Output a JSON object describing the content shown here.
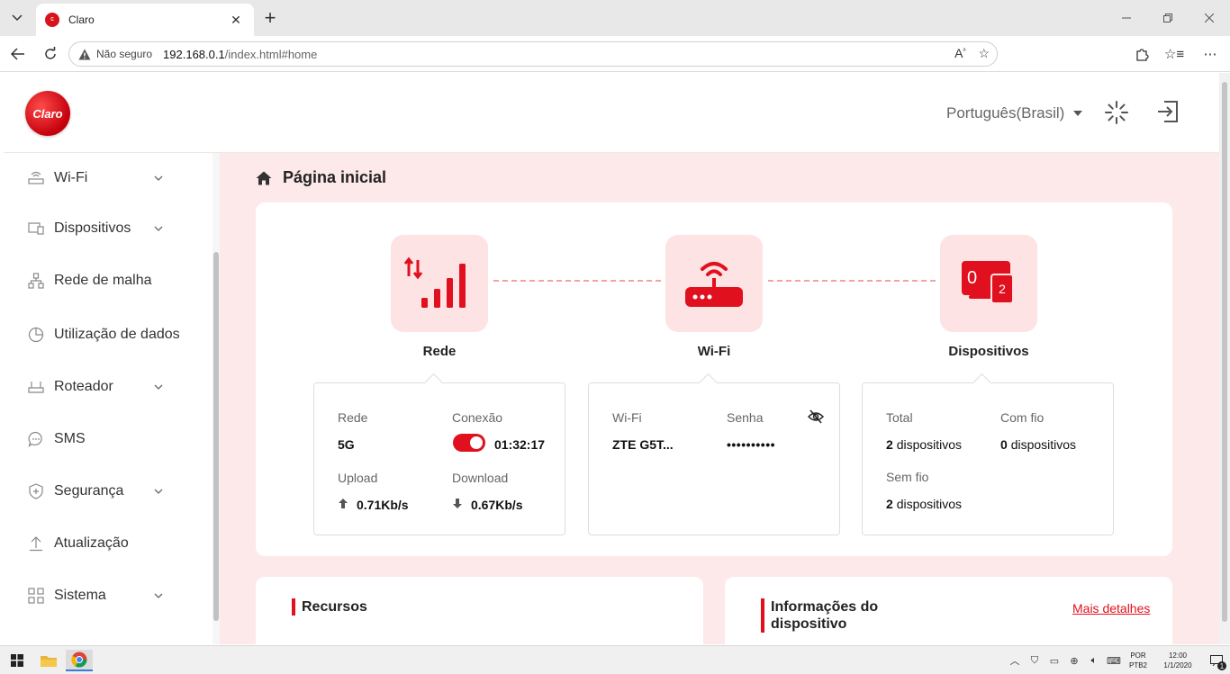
{
  "browser": {
    "tab_title": "Claro",
    "not_secure": "Não seguro",
    "url_host": "192.168.0.1",
    "url_path": "/index.html#home"
  },
  "header": {
    "logo_text": "Claro",
    "language": "Português(Brasil)"
  },
  "sidebar": {
    "items": [
      {
        "label": "Wi-Fi",
        "icon": "router-icon",
        "has_chevron": true
      },
      {
        "label": "Dispositivos",
        "icon": "devices-icon",
        "has_chevron": true
      },
      {
        "label": "Rede de malha",
        "icon": "mesh-icon",
        "has_chevron": false
      },
      {
        "label": "Utilização de dados",
        "icon": "pie-chart-icon",
        "has_chevron": false
      },
      {
        "label": "Roteador",
        "icon": "router-icon",
        "has_chevron": true
      },
      {
        "label": "SMS",
        "icon": "chat-icon",
        "has_chevron": false
      },
      {
        "label": "Segurança",
        "icon": "shield-icon",
        "has_chevron": true
      },
      {
        "label": "Atualização",
        "icon": "upload-icon",
        "has_chevron": false
      },
      {
        "label": "Sistema",
        "icon": "grid-icon",
        "has_chevron": true
      }
    ]
  },
  "main": {
    "page_title": "Página inicial",
    "hubs": {
      "network_label": "Rede",
      "wifi_label": "Wi-Fi",
      "devices_label": "Dispositivos",
      "devices_wired_count": "0",
      "devices_wireless_count": "2"
    },
    "network_box": {
      "network_label": "Rede",
      "network_value": "5G",
      "connection_label": "Conexão",
      "connection_on": true,
      "connection_time": "01:32:17",
      "upload_label": "Upload",
      "upload_value": "0.71Kb/s",
      "download_label": "Download",
      "download_value": "0.67Kb/s"
    },
    "wifi_box": {
      "wifi_label": "Wi-Fi",
      "wifi_value": "ZTE G5T...",
      "password_label": "Senha",
      "password_value": "••••••••••"
    },
    "devices_box": {
      "total_label": "Total",
      "total_count": "2",
      "wired_label": "Com fio",
      "wired_count": "0",
      "wireless_label": "Sem fio",
      "wireless_count": "2",
      "unit": "dispositivos"
    },
    "resources_title": "Recursos",
    "device_info_title_line1": "Informações do",
    "device_info_title_line2": "dispositivo",
    "more_details": "Mais detalhes"
  },
  "taskbar": {
    "lang_line1": "POR",
    "lang_line2": "PTB2",
    "time": "12:00",
    "date": "1/1/2020",
    "notification_count": "1"
  },
  "colors": {
    "brand_red": "#e0101e",
    "hub_bg": "#fde3e3",
    "main_bg": "#fde9e9"
  }
}
